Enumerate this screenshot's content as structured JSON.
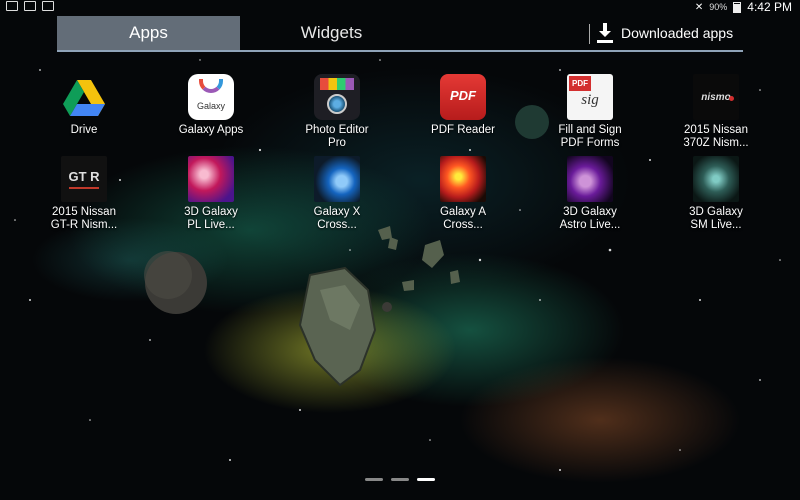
{
  "status_bar": {
    "battery": "90%",
    "time": "4:42 PM"
  },
  "tabs": [
    {
      "label": "Apps",
      "selected": true
    },
    {
      "label": "Widgets",
      "selected": false
    }
  ],
  "downloaded_label": "Downloaded apps",
  "apps": [
    {
      "line1": "Drive",
      "line2": "",
      "icon": "drive-icon"
    },
    {
      "line1": "Galaxy Apps",
      "line2": "",
      "icon": "galaxy-apps-icon"
    },
    {
      "line1": "Photo Editor",
      "line2": "Pro",
      "icon": "photo-editor-icon"
    },
    {
      "line1": "PDF Reader",
      "line2": "",
      "icon": "pdf-reader-icon"
    },
    {
      "line1": "Fill and Sign",
      "line2": "PDF Forms",
      "icon": "fill-sign-icon"
    },
    {
      "line1": "2015 Nissan",
      "line2": "370Z Nism...",
      "icon": "nismo-icon"
    },
    {
      "line1": "2015 Nissan",
      "line2": "GT-R Nism...",
      "icon": "gtr-icon"
    },
    {
      "line1": "3D Galaxy",
      "line2": "PL Live...",
      "icon": "galaxy-pl-icon"
    },
    {
      "line1": "Galaxy X",
      "line2": "Cross...",
      "icon": "galaxy-x-icon"
    },
    {
      "line1": "Galaxy A",
      "line2": "Cross...",
      "icon": "galaxy-a-icon"
    },
    {
      "line1": "3D Galaxy",
      "line2": "Astro Live...",
      "icon": "galaxy-astro-icon"
    },
    {
      "line1": "3D Galaxy",
      "line2": "SM Live...",
      "icon": "galaxy-sm-icon"
    }
  ],
  "icon_text": {
    "galaxy": "Galaxy",
    "pdf": "PDF",
    "sig": "sig",
    "nismo": "nismo",
    "gtr": "GT R"
  },
  "page_indicator": {
    "pages": 3,
    "current": 3
  }
}
